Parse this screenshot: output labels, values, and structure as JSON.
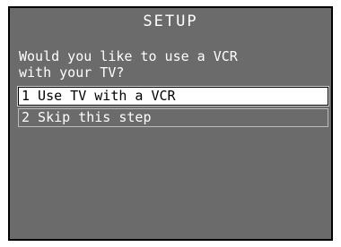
{
  "screen": {
    "title": "SETUP",
    "prompt_line1": "Would you like to use a VCR",
    "prompt_line2": "with your TV?",
    "options": [
      {
        "label": "1 Use TV with a VCR",
        "selected": true
      },
      {
        "label": "2 Skip this step",
        "selected": false
      }
    ]
  },
  "colors": {
    "background": "#6b6b6b",
    "text": "#ffffff",
    "highlight_bg": "#ffffff",
    "highlight_text": "#000000"
  }
}
